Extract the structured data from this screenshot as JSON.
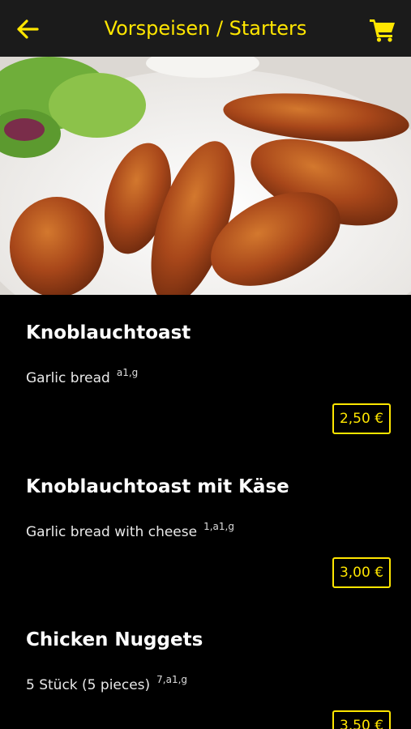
{
  "header": {
    "title": "Vorspeisen / Starters",
    "back_icon": "arrow-left-icon",
    "cart_icon": "shopping-cart-icon",
    "accent_color": "#ffe600"
  },
  "menu": {
    "items": [
      {
        "name": "Knoblauchtoast",
        "description": "Garlic bread",
        "allergens": "a1,g",
        "price": "2,50 €"
      },
      {
        "name": "Knoblauchtoast mit Käse",
        "description": "Garlic bread with cheese",
        "allergens": "1,a1,g",
        "price": "3,00 €"
      },
      {
        "name": "Chicken Nuggets",
        "description": "5 Stück (5 pieces)",
        "allergens": "7,a1,g",
        "price": "3,50 €"
      }
    ]
  }
}
